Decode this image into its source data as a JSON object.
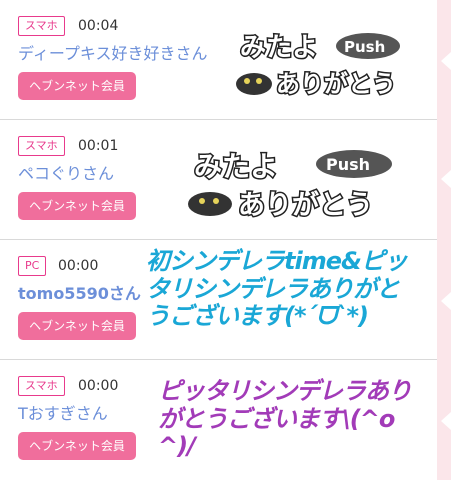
{
  "entries": [
    {
      "device": "スマホ",
      "time": "00:04",
      "name": "ディープキス好き好きさん",
      "member_button": "ヘブンネット会員",
      "stamp": {
        "line1": "みたよ",
        "push": "Push",
        "line2": "ありがとう"
      }
    },
    {
      "device": "スマホ",
      "time": "00:01",
      "name": "ペコぐりさん",
      "member_button": "ヘブンネット会員",
      "stamp": {
        "line1": "みたよ",
        "push": "Push",
        "line2": "ありがとう"
      }
    },
    {
      "device": "PC",
      "time": "00:00",
      "name": "tomo5590さん",
      "member_button": "ヘブンネット会員",
      "message": "初シンデレラtime&ピッタリシンデレラありがとうございます(*ˊᗜˋ*)",
      "message_color": "#1aa7d6"
    },
    {
      "device": "スマホ",
      "time": "00:00",
      "name": "Tおすぎさん",
      "member_button": "ヘブンネット会員",
      "message": "ピッタリシンデレラありがとうございます\\(^o^)/",
      "message_color": "#a23bb8"
    }
  ],
  "colors": {
    "accent_pink": "#f06e9c",
    "badge_pink": "#e83a8c",
    "name_blue": "#6c8fd9"
  }
}
